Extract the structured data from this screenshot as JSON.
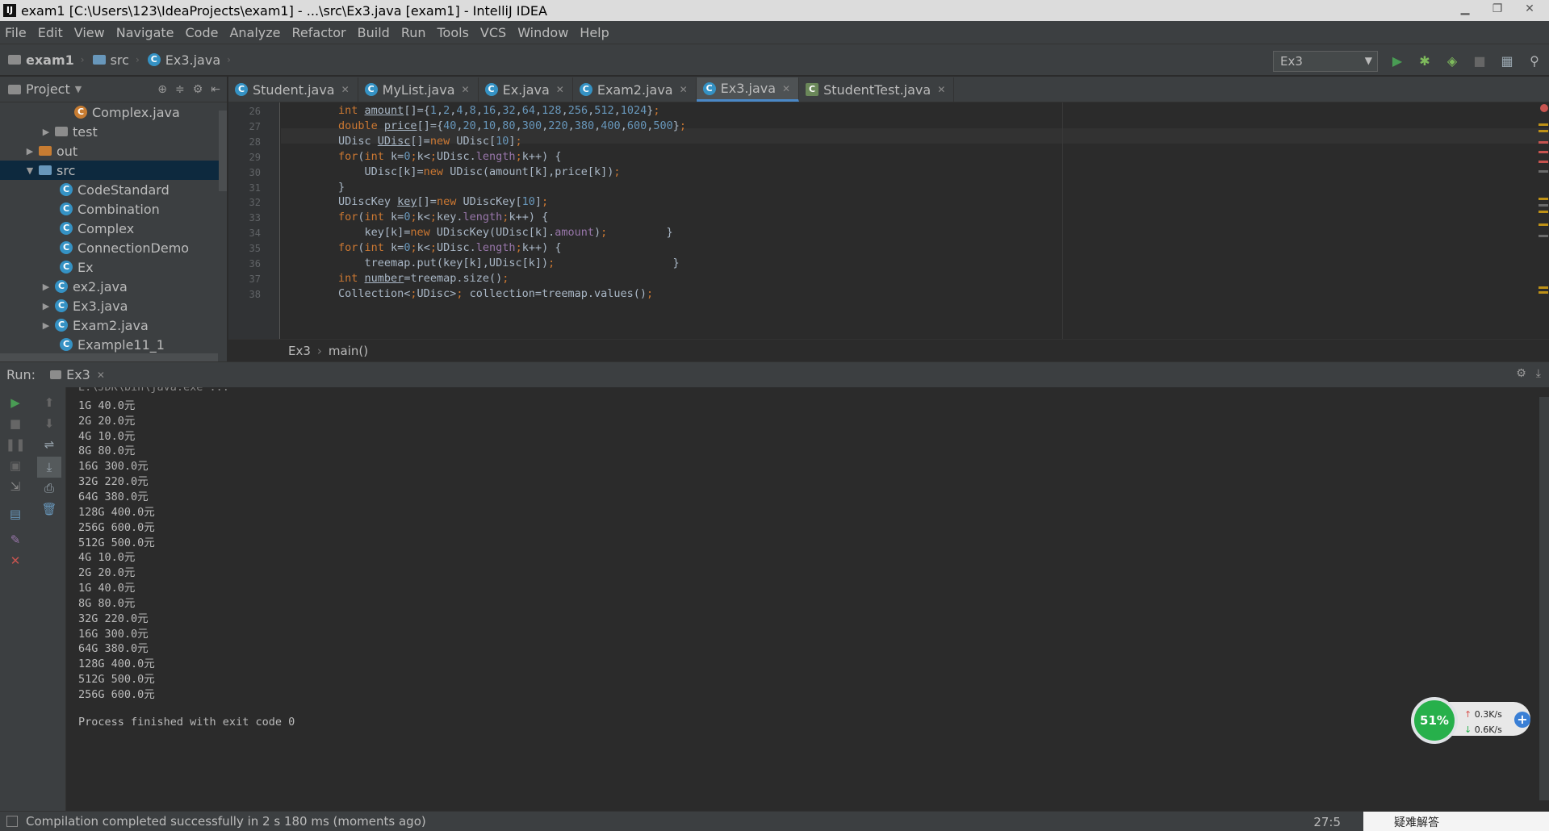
{
  "window": {
    "title": "exam1 [C:\\Users\\123\\IdeaProjects\\exam1] - ...\\src\\Ex3.java [exam1] - IntelliJ IDEA"
  },
  "menu": [
    "File",
    "Edit",
    "View",
    "Navigate",
    "Code",
    "Analyze",
    "Refactor",
    "Build",
    "Run",
    "Tools",
    "VCS",
    "Window",
    "Help"
  ],
  "navbar": {
    "crumbs": [
      "exam1",
      "src",
      "Ex3.java"
    ],
    "run_config": "Ex3"
  },
  "project": {
    "label": "Project",
    "tree": [
      {
        "label": "Complex.java",
        "icon": "java-file-icon"
      },
      {
        "label": "test",
        "icon": "folder-icon"
      },
      {
        "label": "out",
        "icon": "folder-icon"
      },
      {
        "label": "src",
        "icon": "folder-icon"
      },
      {
        "label": "CodeStandard",
        "icon": "class-icon"
      },
      {
        "label": "Combination",
        "icon": "class-icon"
      },
      {
        "label": "Complex",
        "icon": "class-icon"
      },
      {
        "label": "ConnectionDemo",
        "icon": "class-icon"
      },
      {
        "label": "Ex",
        "icon": "class-icon"
      },
      {
        "label": "ex2.java",
        "icon": "class-icon"
      },
      {
        "label": "Ex3.java",
        "icon": "class-icon"
      },
      {
        "label": "Exam2.java",
        "icon": "class-icon"
      },
      {
        "label": "Example11_1",
        "icon": "class-icon"
      }
    ]
  },
  "tabs": [
    "Student.java",
    "MyList.java",
    "Ex.java",
    "Exam2.java",
    "Ex3.java",
    "StudentTest.java"
  ],
  "editor": {
    "line_numbers": [
      "26",
      "27",
      "28",
      "29",
      "30",
      "31",
      "32",
      "33",
      "34",
      "35",
      "36",
      "37",
      "38"
    ],
    "code": [
      {
        "pre": "int ",
        "name": "amount",
        "rest": "[]={1,2,4,8,16,32,64,128,256,512,1024};"
      },
      {
        "pre": "double ",
        "name": "price",
        "rest": "[]={40,20,10,80,300,220,380,400,600,500};"
      },
      {
        "pre": "UDisc ",
        "name": "UDisc",
        "rest": "[]=new UDisc[10];"
      },
      {
        "text": "for(int k=0;k<UDisc.length;k++) {"
      },
      {
        "text": "    UDisc[k]=new UDisc(amount[k],price[k]);"
      },
      {
        "text": "}"
      },
      {
        "pre": "UDiscKey ",
        "name": "key",
        "rest": "[]=new UDiscKey[10];"
      },
      {
        "text": "for(int k=0;k<key.length;k++) {"
      },
      {
        "text": "    key[k]=new UDiscKey(UDisc[k].amount);         }"
      },
      {
        "text": "for(int k=0;k<UDisc.length;k++) {"
      },
      {
        "text": "    treemap.put(key[k],UDisc[k]);                  }"
      },
      {
        "pre": "int ",
        "name": "number",
        "rest": "=treemap.size();"
      },
      {
        "text": "Collection<UDisc> collection=treemap.values();"
      }
    ],
    "breadcrumb": [
      "Ex3",
      "main()"
    ]
  },
  "run": {
    "label": "Run:",
    "tab": "Ex3",
    "output": [
      "E:\\JDK\\bin\\java.exe ...",
      "1G 40.0元",
      "2G 20.0元",
      "4G 10.0元",
      "8G 80.0元",
      "16G 300.0元",
      "32G 220.0元",
      "64G 380.0元",
      "128G 400.0元",
      "256G 600.0元",
      "512G 500.0元",
      "4G 10.0元",
      "2G 20.0元",
      "1G 40.0元",
      "8G 80.0元",
      "32G 220.0元",
      "16G 300.0元",
      "64G 380.0元",
      "128G 400.0元",
      "512G 500.0元",
      "256G 600.0元",
      "",
      "Process finished with exit code 0"
    ]
  },
  "net_widget": {
    "percent": "51%",
    "up": "0.3K/s",
    "down": "0.6K/s"
  },
  "status": {
    "message": "Compilation completed successfully in 2 s 180 ms (moments ago)",
    "position": "27:5",
    "help": "疑难解答"
  },
  "colors": {
    "bg": "#2b2b2b",
    "panel": "#3c3f41",
    "keyword": "#cc7832",
    "number": "#6897bb",
    "field": "#9876aa"
  }
}
